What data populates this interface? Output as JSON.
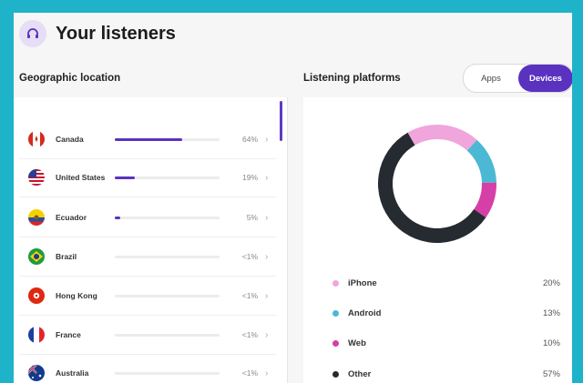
{
  "header": {
    "title": "Your listeners",
    "icon": "headphones-icon"
  },
  "geo": {
    "title": "Geographic location",
    "rows": [
      {
        "country": "Canada",
        "pct_label": "64%",
        "pct": 64,
        "flag": "flag-canada-icon"
      },
      {
        "country": "United States",
        "pct_label": "19%",
        "pct": 19,
        "flag": "flag-usa-icon"
      },
      {
        "country": "Ecuador",
        "pct_label": "5%",
        "pct": 5,
        "flag": "flag-ecuador-icon"
      },
      {
        "country": "Brazil",
        "pct_label": "<1%",
        "pct": 0,
        "flag": "flag-brazil-icon"
      },
      {
        "country": "Hong Kong",
        "pct_label": "<1%",
        "pct": 0,
        "flag": "flag-hongkong-icon"
      },
      {
        "country": "France",
        "pct_label": "<1%",
        "pct": 0,
        "flag": "flag-france-icon"
      },
      {
        "country": "Australia",
        "pct_label": "<1%",
        "pct": 0,
        "flag": "flag-australia-icon"
      }
    ]
  },
  "platforms": {
    "title": "Listening platforms",
    "toggle": {
      "apps": "Apps",
      "devices": "Devices",
      "selected": "Devices"
    },
    "items": [
      {
        "name": "iPhone",
        "pct_label": "20%",
        "pct": 20,
        "color": "#f0a5dc"
      },
      {
        "name": "Android",
        "pct_label": "13%",
        "pct": 13,
        "color": "#4bb8d4"
      },
      {
        "name": "Web",
        "pct_label": "10%",
        "pct": 10,
        "color": "#d63fa6"
      },
      {
        "name": "Other",
        "pct_label": "57%",
        "pct": 57,
        "color": "#262a31"
      }
    ]
  },
  "colors": {
    "accent": "#5a32c0",
    "background": "#1fb3c9"
  }
}
